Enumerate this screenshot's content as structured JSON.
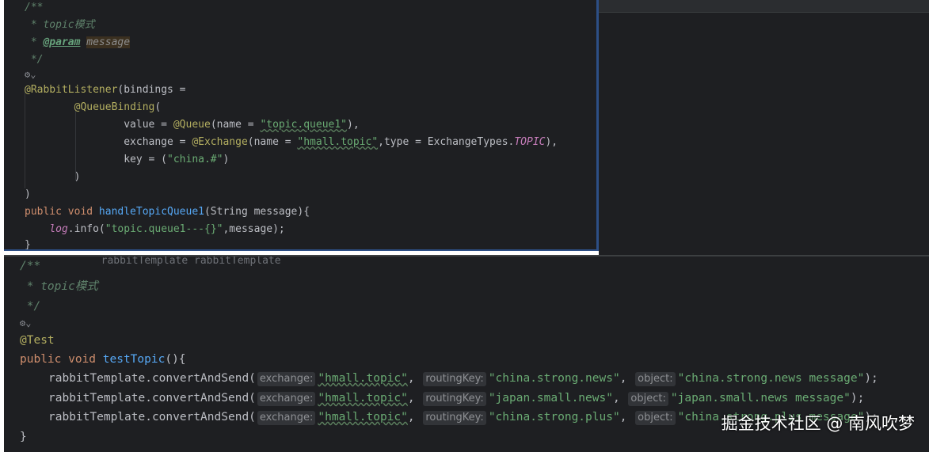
{
  "top": {
    "lines": [
      "/**",
      " * topic模式",
      " * @param message",
      " */",
      "@RabbitListener(bindings =",
      "        @QueueBinding(",
      "                value = @Queue(name = \"topic.queue1\"),",
      "                exchange = @Exchange(name = \"hmall.topic\",type = ExchangeTypes.TOPIC),",
      "                key = (\"china.#\")",
      "        )",
      ")",
      "public void handleTopicQueue1(String message){",
      "    log.info(\"topic.queue1---{}\",message);",
      "}"
    ],
    "gutter_icon": "extension-icon",
    "ghost_text": "        rabbitTemplate rabbitTemplate"
  },
  "bottom": {
    "comment_open": "/**",
    "comment_body": " * topic模式",
    "comment_close": " */",
    "annotation": "@Test",
    "signature_kw": "public void",
    "signature_fn": "testTopic",
    "signature_rest": "(){",
    "closing": "}",
    "calls": [
      {
        "receiver": "rabbitTemplate",
        "method": "convertAndSend",
        "hint_exchange": "exchange:",
        "exchange": "\"hmall.topic\"",
        "hint_routing": "routingKey:",
        "routing": "\"china.strong.news\"",
        "hint_object": "object:",
        "object": "\"china.strong.news message\""
      },
      {
        "receiver": "rabbitTemplate",
        "method": "convertAndSend",
        "hint_exchange": "exchange:",
        "exchange": "\"hmall.topic\"",
        "hint_routing": "routingKey:",
        "routing": "\"japan.small.news\"",
        "hint_object": "object:",
        "object": "\"japan.small.news message\""
      },
      {
        "receiver": "rabbitTemplate",
        "method": "convertAndSend",
        "hint_exchange": "exchange:",
        "exchange": "\"hmall.topic\"",
        "hint_routing": "routingKey:",
        "routing": "\"china.strong.plus\"",
        "hint_object": "object:",
        "object": "\"china.strong.plus message\""
      }
    ]
  },
  "watermark": "掘金技术社区 @ 南风吹梦",
  "colors": {
    "background": "#1e1f22",
    "keyword": "#cf8e6d",
    "string": "#6aab73",
    "annotation": "#b3ae60",
    "function": "#56a8f5",
    "comment": "#5f826b"
  }
}
